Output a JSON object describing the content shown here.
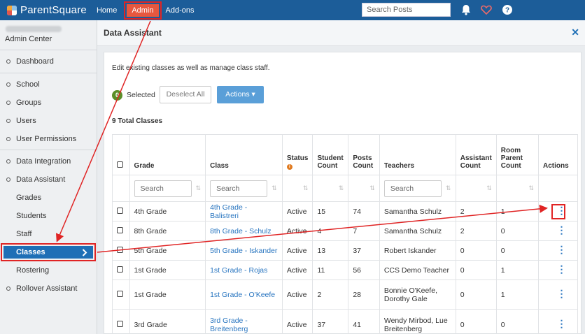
{
  "app": {
    "logo_text": "ParentSquare",
    "nav": [
      "Home",
      "Admin",
      "Add-ons"
    ],
    "search_placeholder": "Search Posts"
  },
  "sidebar": {
    "title": "Admin Center",
    "items": [
      {
        "label": "Dashboard"
      },
      {
        "label": "School"
      },
      {
        "label": "Groups"
      },
      {
        "label": "Users"
      },
      {
        "label": "User Permissions"
      },
      {
        "label": "Data Integration"
      },
      {
        "label": "Data Assistant"
      },
      {
        "label": "Grades"
      },
      {
        "label": "Students"
      },
      {
        "label": "Staff"
      },
      {
        "label": "Classes"
      },
      {
        "label": "Rostering"
      },
      {
        "label": "Rollover Assistant"
      }
    ]
  },
  "main": {
    "page_title": "Data Assistant",
    "description": "Edit existing classes as well as manage class staff.",
    "selected_count": "0",
    "selected_label": "Selected",
    "deselect_label": "Deselect All",
    "actions_label": "Actions",
    "total_label": "9 Total Classes",
    "columns": [
      "Grade",
      "Class",
      "Status",
      "Student Count",
      "Posts Count",
      "Teachers",
      "Assistant Count",
      "Room Parent Count",
      "Actions"
    ],
    "filter_placeholder": "Search",
    "rows": [
      {
        "grade": "4th Grade",
        "class": "4th Grade - Balistreri",
        "status": "Active",
        "students": "15",
        "posts": "74",
        "teachers": "Samantha Schulz",
        "assistants": "2",
        "room_parents": "1"
      },
      {
        "grade": "8th Grade",
        "class": "8th Grade - Schulz",
        "status": "Active",
        "students": "4",
        "posts": "7",
        "teachers": "Samantha Schulz",
        "assistants": "2",
        "room_parents": "0"
      },
      {
        "grade": "5th Grade",
        "class": "5th Grade - Iskander",
        "status": "Active",
        "students": "13",
        "posts": "37",
        "teachers": "Robert Iskander",
        "assistants": "0",
        "room_parents": "0"
      },
      {
        "grade": "1st Grade",
        "class": "1st Grade - Rojas",
        "status": "Active",
        "students": "11",
        "posts": "56",
        "teachers": "CCS Demo Teacher",
        "assistants": "0",
        "room_parents": "1"
      },
      {
        "grade": "1st Grade",
        "class": "1st Grade - O'Keefe",
        "status": "Active",
        "students": "2",
        "posts": "28",
        "teachers": "Bonnie O'Keefe, Dorothy Gale",
        "assistants": "0",
        "room_parents": "1"
      },
      {
        "grade": "3rd Grade",
        "class": "3rd Grade - Breitenberg",
        "status": "Active",
        "students": "37",
        "posts": "41",
        "teachers": "Wendy Mirbod, Lue Breitenberg",
        "assistants": "0",
        "room_parents": "0"
      }
    ]
  },
  "colors": {
    "topbar": "#1c5d99",
    "admin_tab": "#e6573f",
    "highlight_red": "#e02424",
    "active_nav": "#1e6fb6",
    "link": "#2a76c0"
  },
  "icons": [
    "bell-icon",
    "heart-icon",
    "help-icon",
    "info-icon",
    "sort-icon",
    "kebab-icon",
    "close-icon",
    "chevron-right-icon"
  ]
}
